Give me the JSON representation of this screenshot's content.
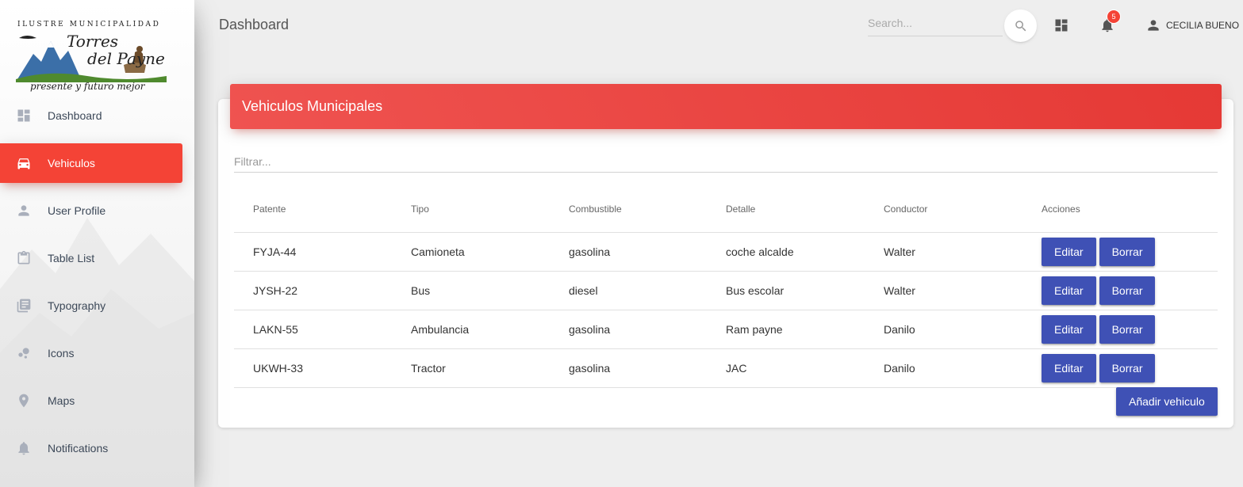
{
  "logo": {
    "top_text": "ILUSTRE MUNICIPALIDAD",
    "name_line1": "Torres",
    "name_line2": "del Payne",
    "tagline": "presente y futuro mejor"
  },
  "sidebar": {
    "items": [
      {
        "label": "Dashboard",
        "icon": "dashboard-icon",
        "active": false
      },
      {
        "label": "Vehiculos",
        "icon": "car-icon",
        "active": true
      },
      {
        "label": "User Profile",
        "icon": "person-icon",
        "active": false
      },
      {
        "label": "Table List",
        "icon": "clipboard-icon",
        "active": false
      },
      {
        "label": "Typography",
        "icon": "library-books-icon",
        "active": false
      },
      {
        "label": "Icons",
        "icon": "bubble-chart-icon",
        "active": false
      },
      {
        "label": "Maps",
        "icon": "location-pin-icon",
        "active": false
      },
      {
        "label": "Notifications",
        "icon": "bell-icon",
        "active": false
      }
    ]
  },
  "topbar": {
    "title": "Dashboard",
    "search_placeholder": "Search...",
    "notification_count": "5",
    "user_name": "CECILIA BUENO"
  },
  "card": {
    "title": "Vehiculos Municipales",
    "filter_placeholder": "Filtrar...",
    "columns": [
      "Patente",
      "Tipo",
      "Combustible",
      "Detalle",
      "Conductor",
      "Acciones"
    ],
    "rows": [
      {
        "patente": "FYJA-44",
        "tipo": "Camioneta",
        "combustible": "gasolina",
        "detalle": "coche alcalde",
        "conductor": "Walter"
      },
      {
        "patente": "JYSH-22",
        "tipo": "Bus",
        "combustible": "diesel",
        "detalle": "Bus escolar",
        "conductor": "Walter"
      },
      {
        "patente": "LAKN-55",
        "tipo": "Ambulancia",
        "combustible": "gasolina",
        "detalle": "Ram payne",
        "conductor": "Danilo"
      },
      {
        "patente": "UKWH-33",
        "tipo": "Tractor",
        "combustible": "gasolina",
        "detalle": "JAC",
        "conductor": "Danilo"
      }
    ],
    "edit_label": "Editar",
    "delete_label": "Borrar",
    "add_label": "Añadir vehiculo"
  },
  "colors": {
    "accent_red": "#f44336",
    "button_indigo": "#3f51b5",
    "header_gradient_start": "#ef5350",
    "header_gradient_end": "#e53935"
  }
}
